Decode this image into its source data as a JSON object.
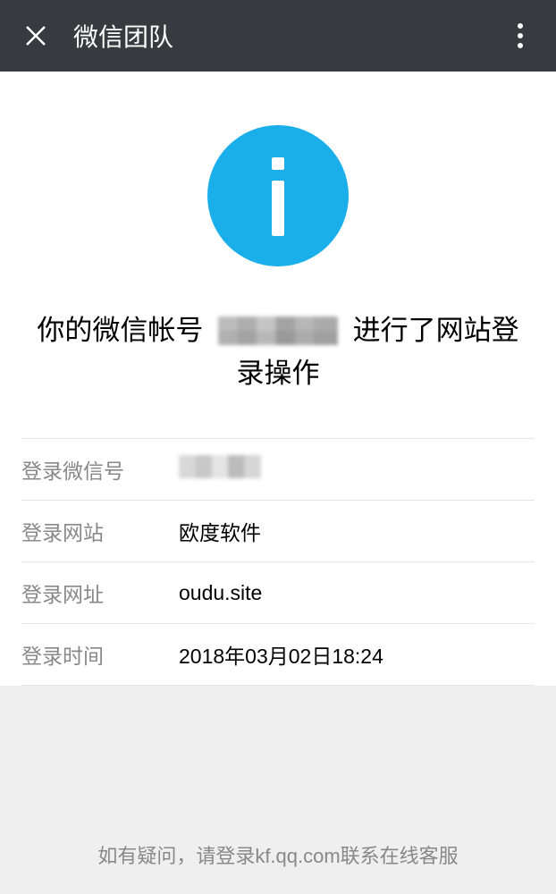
{
  "header": {
    "title": "微信团队"
  },
  "info": {
    "title_prefix": "你的微信帐号",
    "title_suffix": "进行了网站登录操作"
  },
  "details": {
    "account_label": "登录微信号",
    "site_label": "登录网站",
    "site_value": "欧度软件",
    "url_label": "登录网址",
    "url_value": "oudu.site",
    "time_label": "登录时间",
    "time_value": "2018年03月02日18:24"
  },
  "footer": {
    "text": "如有疑问，请登录kf.qq.com联系在线客服"
  }
}
